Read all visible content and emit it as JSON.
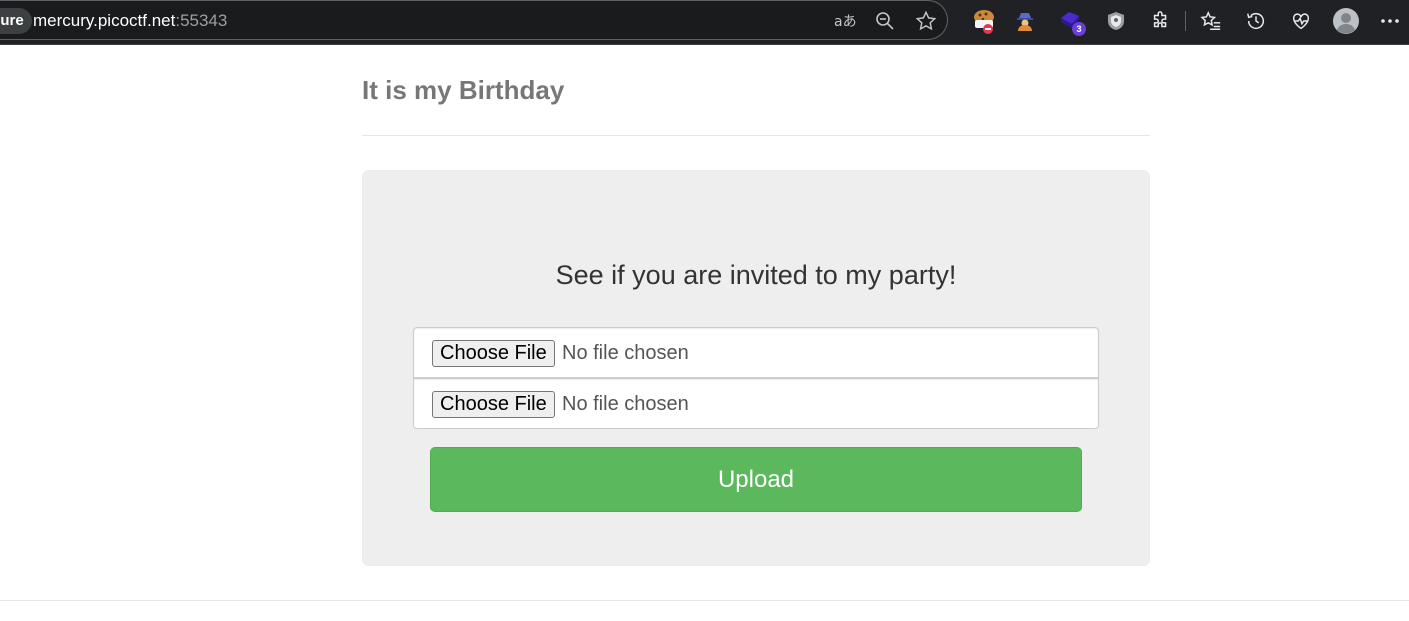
{
  "browser": {
    "security_chip": "cure",
    "url_host": "mercury.picoctf.net",
    "url_port": ":55343",
    "extension_badge": "3"
  },
  "page": {
    "header_title": "It is my Birthday",
    "lead_text": "See if you are invited to my party!",
    "file_inputs": [
      {
        "button_label": "Choose File",
        "status": "No file chosen"
      },
      {
        "button_label": "Choose File",
        "status": "No file chosen"
      }
    ],
    "submit_label": "Upload"
  },
  "colors": {
    "upload_button": "#5cb85c",
    "jumbotron_bg": "#eeeeee",
    "toolbar_bg": "#202124"
  }
}
